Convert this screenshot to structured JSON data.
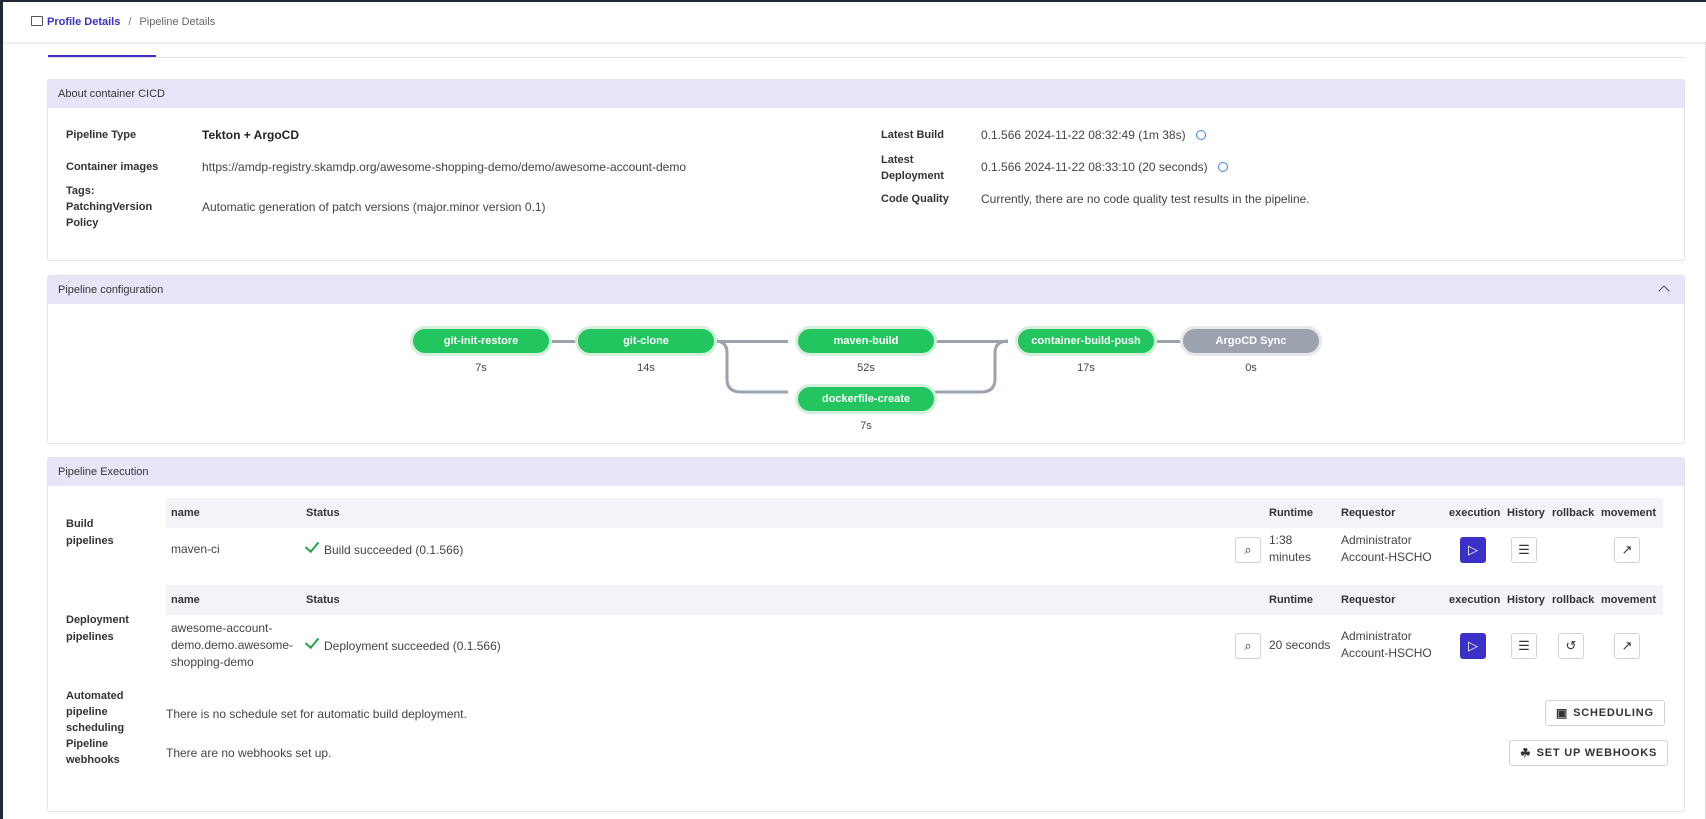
{
  "breadcrumb": {
    "link": "Profile Details",
    "separator": "/",
    "current": "Pipeline Details"
  },
  "about": {
    "title": "About container CICD",
    "pipeline_type_label": "Pipeline Type",
    "pipeline_type": "Tekton + ArgoCD",
    "container_images_label": "Container images",
    "container_images": "https://amdp-registry.skamdp.org/awesome-shopping-demo/demo/awesome-account-demo",
    "tags_label": "Tags:",
    "patching_label_1": "PatchingVersion",
    "patching_label_2": "Policy",
    "patching_value": "Automatic generation of patch versions (major.minor version 0.1)",
    "latest_build_label": "Latest Build",
    "latest_build": "0.1.566 2024-11-22 08:32:49 (1m 38s)",
    "latest_deploy_label_1": "Latest",
    "latest_deploy_label_2": "Deployment",
    "latest_deploy": "0.1.566 2024-11-22 08:33:10 (20 seconds)",
    "code_quality_label": "Code Quality",
    "code_quality": "Currently, there are no code quality test results in the pipeline."
  },
  "config": {
    "title": "Pipeline configuration",
    "nodes": [
      {
        "name": "git-init-restore",
        "duration": "7s"
      },
      {
        "name": "git-clone",
        "duration": "14s"
      },
      {
        "name": "maven-build",
        "duration": "52s"
      },
      {
        "name": "dockerfile-create",
        "duration": "7s"
      },
      {
        "name": "container-build-push",
        "duration": "17s"
      },
      {
        "name": "ArgoCD Sync",
        "duration": "0s"
      }
    ]
  },
  "execution": {
    "title": "Pipeline Execution",
    "columns": {
      "name": "name",
      "status": "Status",
      "runtime": "Runtime",
      "requestor": "Requestor",
      "execution": "execution",
      "history": "History",
      "rollback": "rollback",
      "movement": "movement"
    },
    "build_label_1": "Build",
    "build_label_2": "pipelines",
    "build_row": {
      "name": "maven-ci",
      "status": "Build succeeded (0.1.566)",
      "runtime_1": "1:38",
      "runtime_2": "minutes",
      "requestor_1": "Administrator",
      "requestor_2": "Account-HSCHO"
    },
    "deploy_label_1": "Deployment",
    "deploy_label_2": "pipelines",
    "deploy_row": {
      "name_1": "awesome-account-",
      "name_2": "demo.demo.awesome-",
      "name_3": "shopping-demo",
      "status": "Deployment succeeded (0.1.566)",
      "runtime": "20 seconds",
      "requestor_1": "Administrator",
      "requestor_2": "Account-HSCHO"
    },
    "sched_label_1": "Automated",
    "sched_label_2": "pipeline",
    "sched_label_3": "scheduling",
    "sched_text": "There is no schedule set for automatic build deployment.",
    "sched_button": "SCHEDULING",
    "webhook_label_1": "Pipeline",
    "webhook_label_2": "webhooks",
    "webhook_text": "There are no webhooks set up.",
    "webhook_button": "SET UP WEBHOOKS"
  }
}
